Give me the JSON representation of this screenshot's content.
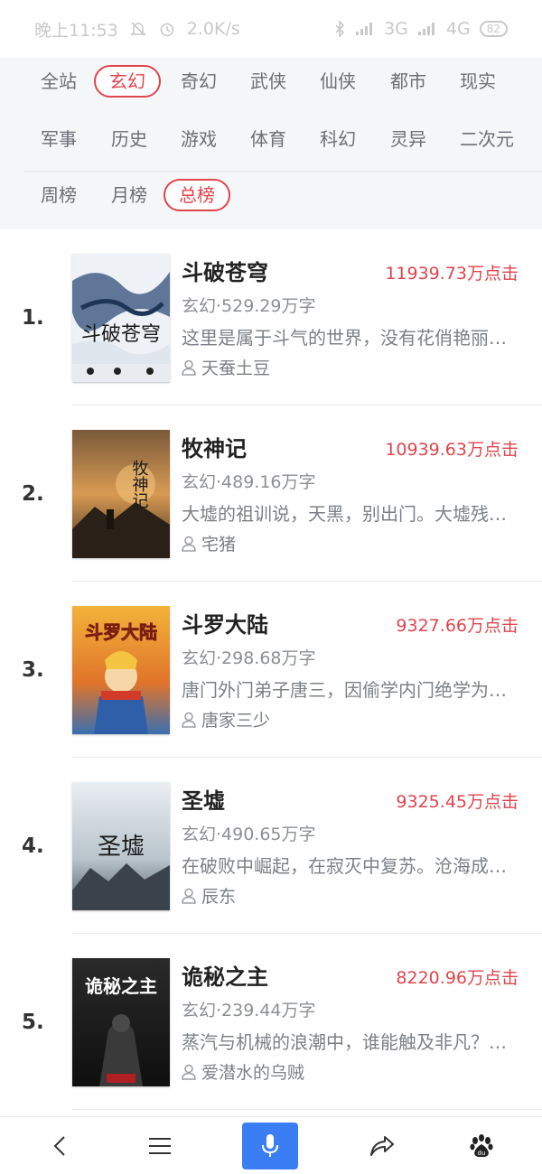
{
  "status_bar": {
    "time": "晚上11:53",
    "speed": "2.0K/s",
    "network_3g": "3G",
    "network_4g": "4G",
    "battery": "82",
    "icons": [
      "mute-bell-icon",
      "alarm-icon",
      "bluetooth-icon",
      "signal-icon",
      "battery-icon"
    ]
  },
  "categories": [
    {
      "label": "全站",
      "active": false
    },
    {
      "label": "玄幻",
      "active": true
    },
    {
      "label": "奇幻",
      "active": false
    },
    {
      "label": "武侠",
      "active": false
    },
    {
      "label": "仙侠",
      "active": false
    },
    {
      "label": "都市",
      "active": false
    },
    {
      "label": "现实",
      "active": false
    },
    {
      "label": "军事",
      "active": false
    },
    {
      "label": "历史",
      "active": false
    },
    {
      "label": "游戏",
      "active": false
    },
    {
      "label": "体育",
      "active": false
    },
    {
      "label": "科幻",
      "active": false
    },
    {
      "label": "灵异",
      "active": false
    },
    {
      "label": "二次元",
      "active": false
    }
  ],
  "periods": [
    {
      "label": "周榜",
      "active": false
    },
    {
      "label": "月榜",
      "active": false
    },
    {
      "label": "总榜",
      "active": true
    }
  ],
  "books": [
    {
      "rank": "1.",
      "title": "斗破苍穹",
      "clicks": "11939.73万点击",
      "meta": "玄幻·529.29万字",
      "desc": "这里是属于斗气的世界，没有花俏艳丽的魔法",
      "author": "天蚕土豆",
      "cover_text": "斗破苍穹"
    },
    {
      "rank": "2.",
      "title": "牧神记",
      "clicks": "10939.63万点击",
      "meta": "玄幻·489.16万字",
      "desc": "大墟的祖训说，天黑，别出门。大墟残老村的",
      "author": "宅猪",
      "cover_text": "牧神记"
    },
    {
      "rank": "3.",
      "title": "斗罗大陆",
      "clicks": "9327.66万点击",
      "meta": "玄幻·298.68万字",
      "desc": "唐门外门弟子唐三，因偷学内门绝学为唐门所",
      "author": "唐家三少",
      "cover_text": "斗罗大陆"
    },
    {
      "rank": "4.",
      "title": "圣墟",
      "clicks": "9325.45万点击",
      "meta": "玄幻·490.65万字",
      "desc": "在破败中崛起，在寂灭中复苏。沧海成尘，雷",
      "author": "辰东",
      "cover_text": "圣墟"
    },
    {
      "rank": "5.",
      "title": "诡秘之主",
      "clicks": "8220.96万点击",
      "meta": "玄幻·239.44万字",
      "desc": "蒸汽与机械的浪潮中，谁能触及非凡？历史和",
      "author": "爱潜水的乌贼",
      "cover_text": "诡秘之主"
    }
  ],
  "colors": {
    "accent": "#e0444d",
    "mic_button": "#3b7ef4",
    "filter_background": "#f4f6f8"
  },
  "bottom_nav": {
    "icons": [
      "back-icon",
      "menu-icon",
      "microphone-icon",
      "share-icon",
      "baidu-paw-icon"
    ]
  }
}
